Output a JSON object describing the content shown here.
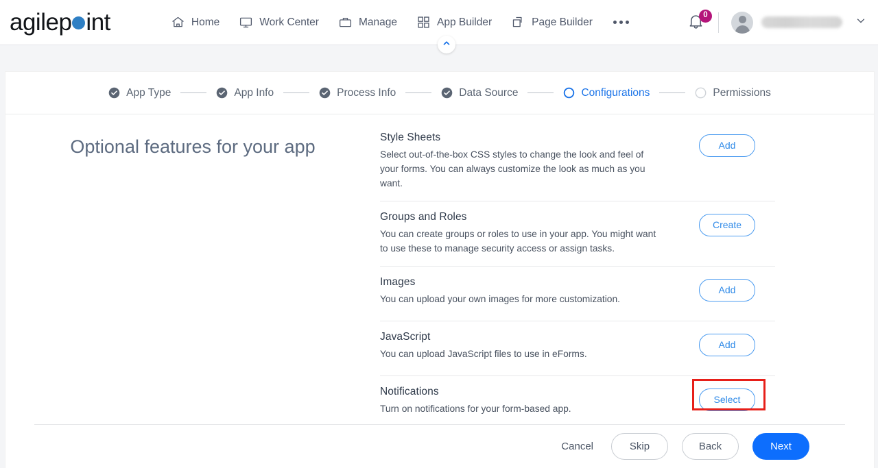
{
  "brand": {
    "name_part1": "agilep",
    "name_part2": "int",
    "dot_color": "#2E7FC4"
  },
  "topnav": {
    "items": [
      {
        "label": "Home",
        "icon": "home-icon"
      },
      {
        "label": "Work Center",
        "icon": "monitor-icon"
      },
      {
        "label": "Manage",
        "icon": "briefcase-icon"
      },
      {
        "label": "App Builder",
        "icon": "grid-icon"
      },
      {
        "label": "Page Builder",
        "icon": "copy-pages-icon"
      }
    ],
    "more_label": "•••",
    "notification_count": "0",
    "user_name": "",
    "collapse_icon": "chevron-up-icon"
  },
  "stepper": {
    "steps": [
      {
        "label": "App Type",
        "state": "complete"
      },
      {
        "label": "App Info",
        "state": "complete"
      },
      {
        "label": "Process Info",
        "state": "complete"
      },
      {
        "label": "Data Source",
        "state": "complete"
      },
      {
        "label": "Configurations",
        "state": "active"
      },
      {
        "label": "Permissions",
        "state": "pending"
      }
    ]
  },
  "main": {
    "heading": "Optional features for your app",
    "features": [
      {
        "title": "Style Sheets",
        "description": "Select out-of-the-box CSS styles to change the look and feel of your forms. You can always customize the look as much as you want.",
        "button": "Add",
        "highlighted": false
      },
      {
        "title": "Groups and Roles",
        "description": "You can create groups or roles to use in your app. You might want to use these to manage security access or assign tasks.",
        "button": "Create",
        "highlighted": false
      },
      {
        "title": "Images",
        "description": "You can upload your own images for more customization.",
        "button": "Add",
        "highlighted": false
      },
      {
        "title": "JavaScript",
        "description": "You can upload JavaScript files to use in eForms.",
        "button": "Add",
        "highlighted": false
      },
      {
        "title": "Notifications",
        "description": "Turn on notifications for your form-based app.",
        "button": "Select",
        "highlighted": true
      }
    ]
  },
  "footer": {
    "cancel": "Cancel",
    "skip": "Skip",
    "back": "Back",
    "next": "Next"
  },
  "colors": {
    "accent_blue": "#1a73e8",
    "primary_button": "#0d6efd",
    "outline_blue": "#2f8ae8",
    "highlight_red": "#e71f19",
    "badge_magenta": "#b4147a"
  }
}
